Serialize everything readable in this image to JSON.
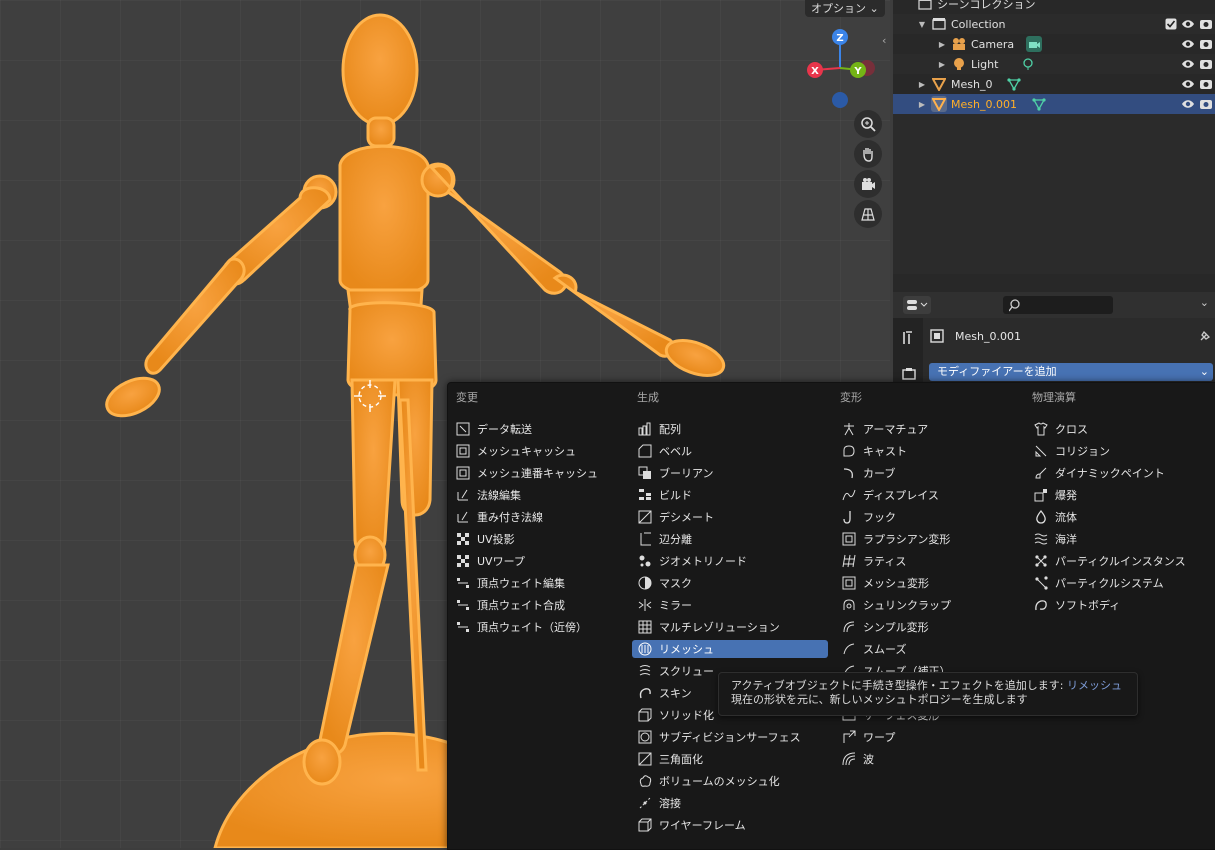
{
  "viewport": {
    "options_label": "オプション",
    "gizmo_axes": {
      "z": "Z",
      "x": "X",
      "y": "Y"
    }
  },
  "outliner": {
    "root": "シーンコレクション",
    "rows": [
      {
        "label": "Collection"
      },
      {
        "label": "Camera"
      },
      {
        "label": "Light"
      },
      {
        "label": "Mesh_0"
      },
      {
        "label": "Mesh_0.001"
      }
    ]
  },
  "properties": {
    "object_name": "Mesh_0.001",
    "add_modifier_label": "モディファイアーを追加"
  },
  "menu": {
    "columns": [
      {
        "heading": "変更",
        "items": [
          "データ転送",
          "メッシュキャッシュ",
          "メッシュ連番キャッシュ",
          "法線編集",
          "重み付き法線",
          "UV投影",
          "UVワープ",
          "頂点ウェイト編集",
          "頂点ウェイト合成",
          "頂点ウェイト（近傍）"
        ]
      },
      {
        "heading": "生成",
        "items": [
          "配列",
          "ベベル",
          "ブーリアン",
          "ビルド",
          "デシメート",
          "辺分離",
          "ジオメトリノード",
          "マスク",
          "ミラー",
          "マルチレゾリューション",
          "リメッシュ",
          "スクリュー",
          "スキン",
          "ソリッド化",
          "サブディビジョンサーフェス",
          "三角面化",
          "ボリュームのメッシュ化",
          "溶接",
          "ワイヤーフレーム"
        ]
      },
      {
        "heading": "変形",
        "items": [
          "アーマチュア",
          "キャスト",
          "カーブ",
          "ディスプレイス",
          "フック",
          "ラプラシアン変形",
          "ラティス",
          "メッシュ変形",
          "シュリンクラップ",
          "シンプル変形",
          "スムーズ",
          "スムーズ（補正）",
          "サーフェス変形",
          "ワープ",
          "波"
        ]
      },
      {
        "heading": "物理演算",
        "items": [
          "クロス",
          "コリジョン",
          "ダイナミックペイント",
          "爆発",
          "流体",
          "海洋",
          "パーティクルインスタンス",
          "パーティクルシステム",
          "ソフトボディ"
        ]
      }
    ]
  },
  "tooltip": {
    "line1_prefix": "アクティブオブジェクトに手続き型操作・エフェクトを追加します: ",
    "line1_name": "リメッシュ",
    "line2": "現在の形状を元に、新しいメッシュトポロジーを生成します"
  },
  "colors": {
    "accent_blue": "#4772b3",
    "selection_orange": "#ffaf29",
    "mesh_orange": "#f5941d"
  }
}
